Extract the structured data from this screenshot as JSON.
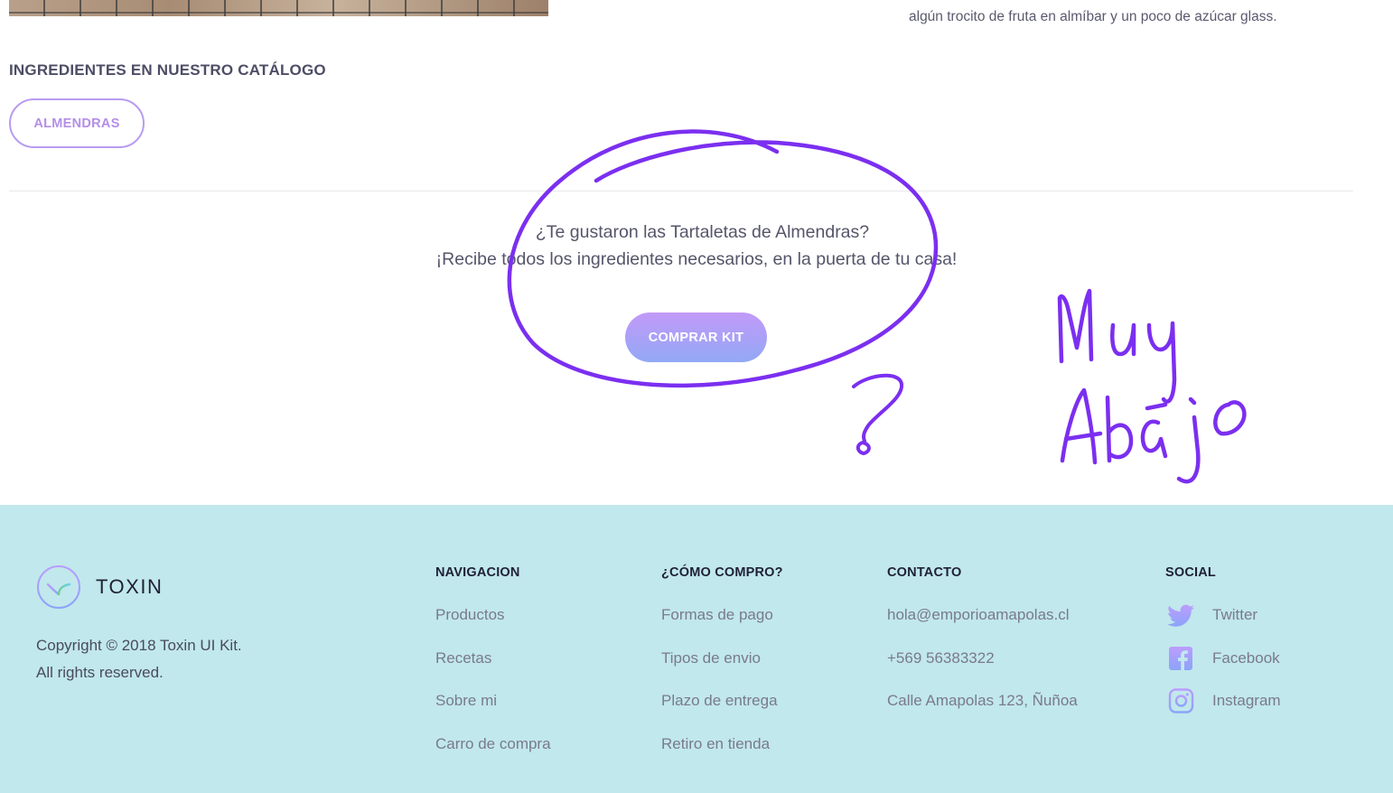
{
  "recipe": {
    "step_text": "algún trocito de fruta en almíbar y un poco de azúcar glass."
  },
  "ingredients": {
    "heading": "INGREDIENTES EN NUESTRO CATÁLOGO",
    "tags": [
      "ALMENDRAS"
    ]
  },
  "cta": {
    "line1": "¿Te gustaron las  Tartaletas de Almendras?",
    "line2": "¡Recibe todos los ingredientes necesarios, en la puerta de tu casa!",
    "button_label": "COMPRAR KIT"
  },
  "annotation": {
    "handwritten_note": "Muy Abajo",
    "question_mark": "?",
    "stroke_color": "#7b2ff0"
  },
  "footer": {
    "brand": "TOXIN",
    "copyright_line1": "Copyright © 2018 Toxin UI Kit.",
    "copyright_line2": "All rights reserved.",
    "columns": {
      "navigation": {
        "title": "NAVIGACION",
        "items": [
          "Productos",
          "Recetas",
          "Sobre mi",
          "Carro de compra"
        ]
      },
      "how_to_buy": {
        "title": "¿CÓMO COMPRO?",
        "items": [
          "Formas de pago",
          "Tipos de envio",
          "Plazo de entrega",
          "Retiro en tienda"
        ]
      },
      "contact": {
        "title": "CONTACTO",
        "items": [
          "hola@emporioamapolas.cl",
          "+569 56383322",
          "Calle Amapolas 123, Ñuñoa"
        ]
      },
      "social": {
        "title": "SOCIAL",
        "items": [
          {
            "label": "Twitter",
            "icon": "twitter-icon"
          },
          {
            "label": "Facebook",
            "icon": "facebook-icon"
          },
          {
            "label": "Instagram",
            "icon": "instagram-icon"
          }
        ]
      }
    }
  },
  "colors": {
    "accent_purple": "#bc9cff",
    "accent_blue": "#8ba4f9",
    "footer_bg": "#c1e8ec",
    "annotation_purple": "#7b2ff0"
  }
}
